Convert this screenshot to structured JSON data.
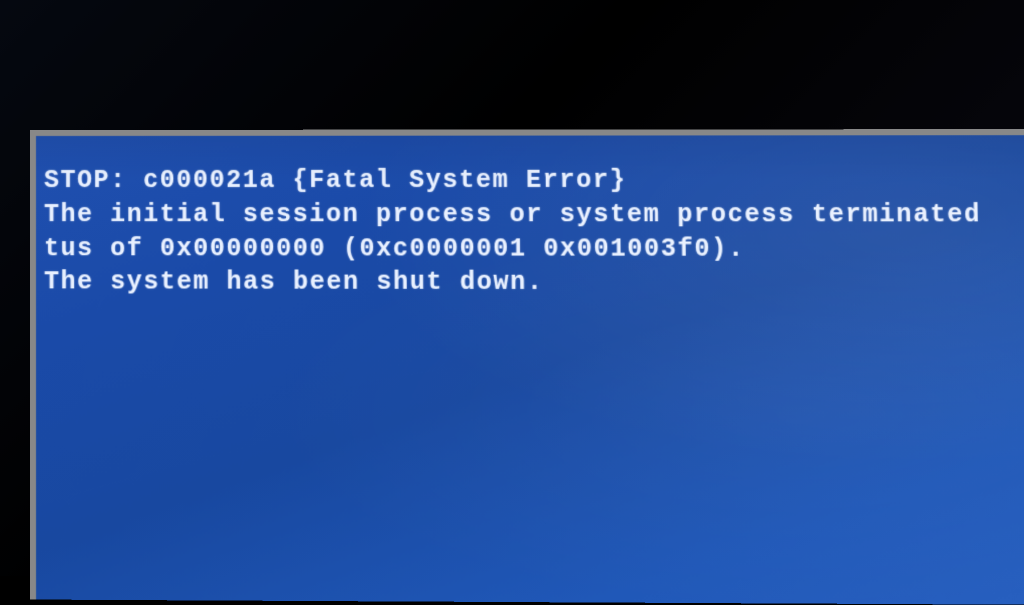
{
  "bsod": {
    "line1": "STOP: c000021a {Fatal System Error}",
    "line2": "The initial session process or system process terminated",
    "line3": "tus of 0x00000000 (0xc0000001 0x001003f0).",
    "line4": "The system has been shut down."
  }
}
